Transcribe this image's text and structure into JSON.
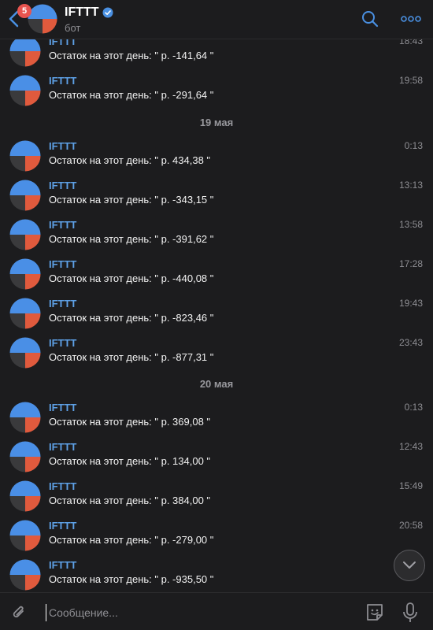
{
  "header": {
    "badge_count": "5",
    "title": "IFTTT",
    "subtitle": "бот",
    "icons": [
      "back-icon",
      "verified-icon",
      "search-icon",
      "more-icon"
    ]
  },
  "colors": {
    "background": "#1c1c1e",
    "sender": "#5ea1e7",
    "accent": "#4a90e2",
    "avatar_blue": "#4a8fe6",
    "avatar_red": "#e05a3d"
  },
  "messages": [
    {
      "sender": "IFTTT",
      "text": "Остаток на этот день: \" р. -141,64 \"",
      "time": "18:43"
    },
    {
      "sender": "IFTTT",
      "text": "Остаток на этот день: \" р. -291,64 \"",
      "time": "19:58"
    },
    {
      "sender": "IFTTT",
      "text": "Остаток на этот день: \" р. 434,38 \"",
      "time": "0:13"
    },
    {
      "sender": "IFTTT",
      "text": "Остаток на этот день: \" р. -343,15 \"",
      "time": "13:13"
    },
    {
      "sender": "IFTTT",
      "text": "Остаток на этот день: \" р. -391,62 \"",
      "time": "13:58"
    },
    {
      "sender": "IFTTT",
      "text": "Остаток на этот день: \" р. -440,08 \"",
      "time": "17:28"
    },
    {
      "sender": "IFTTT",
      "text": "Остаток на этот день: \" р. -823,46 \"",
      "time": "19:43"
    },
    {
      "sender": "IFTTT",
      "text": "Остаток на этот день: \" р. -877,31 \"",
      "time": "23:43"
    },
    {
      "sender": "IFTTT",
      "text": "Остаток на этот день: \" р. 369,08 \"",
      "time": "0:13"
    },
    {
      "sender": "IFTTT",
      "text": "Остаток на этот день: \" р. 134,00 \"",
      "time": "12:43"
    },
    {
      "sender": "IFTTT",
      "text": "Остаток на этот день: \" р. 384,00 \"",
      "time": "15:49"
    },
    {
      "sender": "IFTTT",
      "text": "Остаток на этот день: \" р. -279,00 \"",
      "time": "20:58"
    },
    {
      "sender": "IFTTT",
      "text": "Остаток на этот день: \" р. -935,50 \"",
      "time": ""
    }
  ],
  "dates": [
    "19 мая",
    "20 мая"
  ],
  "composer": {
    "placeholder": "Сообщение...",
    "icons": [
      "attach-icon",
      "sticker-icon",
      "microphone-icon"
    ]
  },
  "scroll_button_icon": "chevron-down-icon"
}
